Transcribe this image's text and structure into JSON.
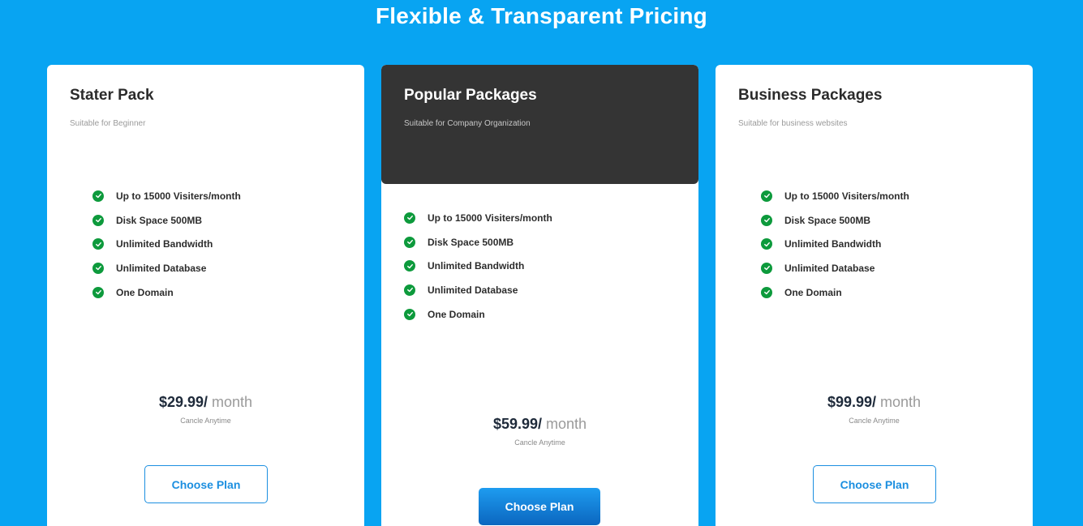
{
  "section": {
    "title": "Flexible & Transparent Pricing"
  },
  "colors": {
    "background": "#08a4f2",
    "check": "#0d9a3c",
    "accent": "#1c8fe0",
    "dark_header": "#343434"
  },
  "plans": [
    {
      "name": "Stater Pack",
      "subtitle": "Suitable for Beginner",
      "features": [
        "Up to 15000 Visiters/month",
        "Disk Space 500MB",
        "Unlimited Bandwidth",
        "Unlimited Database",
        "One Domain"
      ],
      "price": "$29.99",
      "separator": "/",
      "period": "month",
      "note": "Cancle Anytime",
      "button": "Choose Plan"
    },
    {
      "name": "Popular Packages",
      "subtitle": "Suitable for Company Organization",
      "features": [
        "Up to 15000 Visiters/month",
        "Disk Space 500MB",
        "Unlimited Bandwidth",
        "Unlimited Database",
        "One Domain"
      ],
      "price": "$59.99",
      "separator": "/",
      "period": "month",
      "note": "Cancle Anytime",
      "button": "Choose Plan"
    },
    {
      "name": "Business Packages",
      "subtitle": "Suitable for business websites",
      "features": [
        "Up to 15000 Visiters/month",
        "Disk Space 500MB",
        "Unlimited Bandwidth",
        "Unlimited Database",
        "One Domain"
      ],
      "price": "$99.99",
      "separator": "/",
      "period": "month",
      "note": "Cancle Anytime",
      "button": "Choose Plan"
    }
  ]
}
